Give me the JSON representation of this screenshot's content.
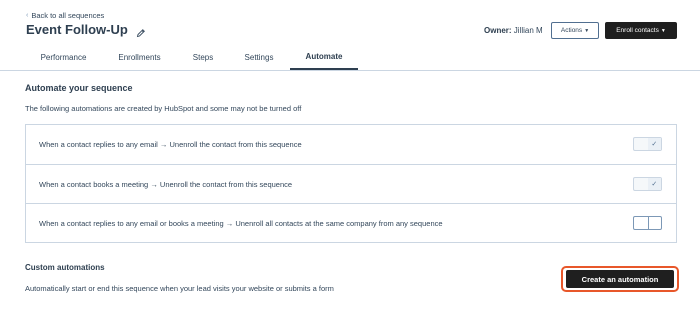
{
  "header": {
    "back_link": "Back to all sequences",
    "title": "Event Follow-Up",
    "owner_label": "Owner:",
    "owner_name": "Jillian M",
    "actions_label": "Actions",
    "enroll_label": "Enroll contacts"
  },
  "tabs": [
    {
      "label": "Performance",
      "active": false
    },
    {
      "label": "Enrollments",
      "active": false
    },
    {
      "label": "Steps",
      "active": false
    },
    {
      "label": "Settings",
      "active": false
    },
    {
      "label": "Automate",
      "active": true
    }
  ],
  "automate": {
    "title": "Automate your sequence",
    "description": "The following automations are created by HubSpot and some may not be turned off",
    "rows": [
      {
        "text": "When a contact replies to any email → Unenroll the contact from this sequence",
        "enabled": true
      },
      {
        "text": "When a contact books a meeting → Unenroll the contact from this sequence",
        "enabled": true
      },
      {
        "text": "When a contact replies to any email or books a meeting → Unenroll all contacts at the same company from any sequence",
        "enabled": false
      }
    ]
  },
  "custom": {
    "title": "Custom automations",
    "description": "Automatically start or end this sequence when your lead visits your website or submits a form",
    "button_label": "Create an automation"
  },
  "icons": {
    "back": "chevron-left-icon",
    "edit": "pencil-icon",
    "dropdown": "caret-down-icon",
    "check": "checkmark-icon"
  },
  "colors": {
    "highlight": "#e8572a",
    "primary_button": "#1f1f1f",
    "text": "#33475b",
    "border": "#cbd6e2"
  }
}
